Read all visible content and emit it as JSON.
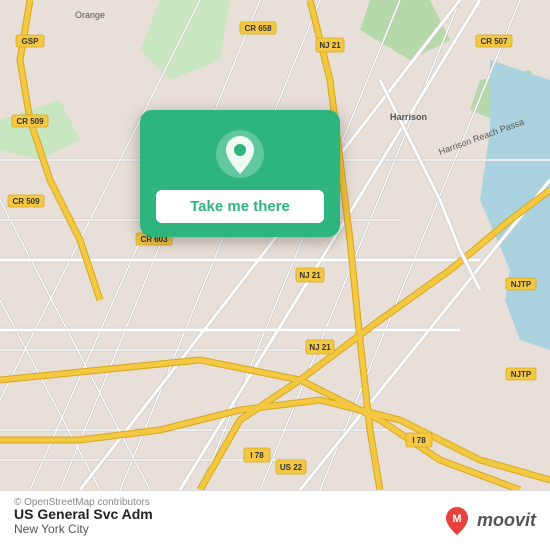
{
  "map": {
    "alt": "Map of US General Svc Adm area, New York City"
  },
  "popup": {
    "button_label": "Take me there"
  },
  "bottom_bar": {
    "copyright": "© OpenStreetMap contributors",
    "location_name": "US General Svc Adm",
    "location_city": "New York City",
    "moovit_text": "moovit"
  },
  "colors": {
    "green_accent": "#2db57d",
    "moovit_red": "#e8413e"
  }
}
